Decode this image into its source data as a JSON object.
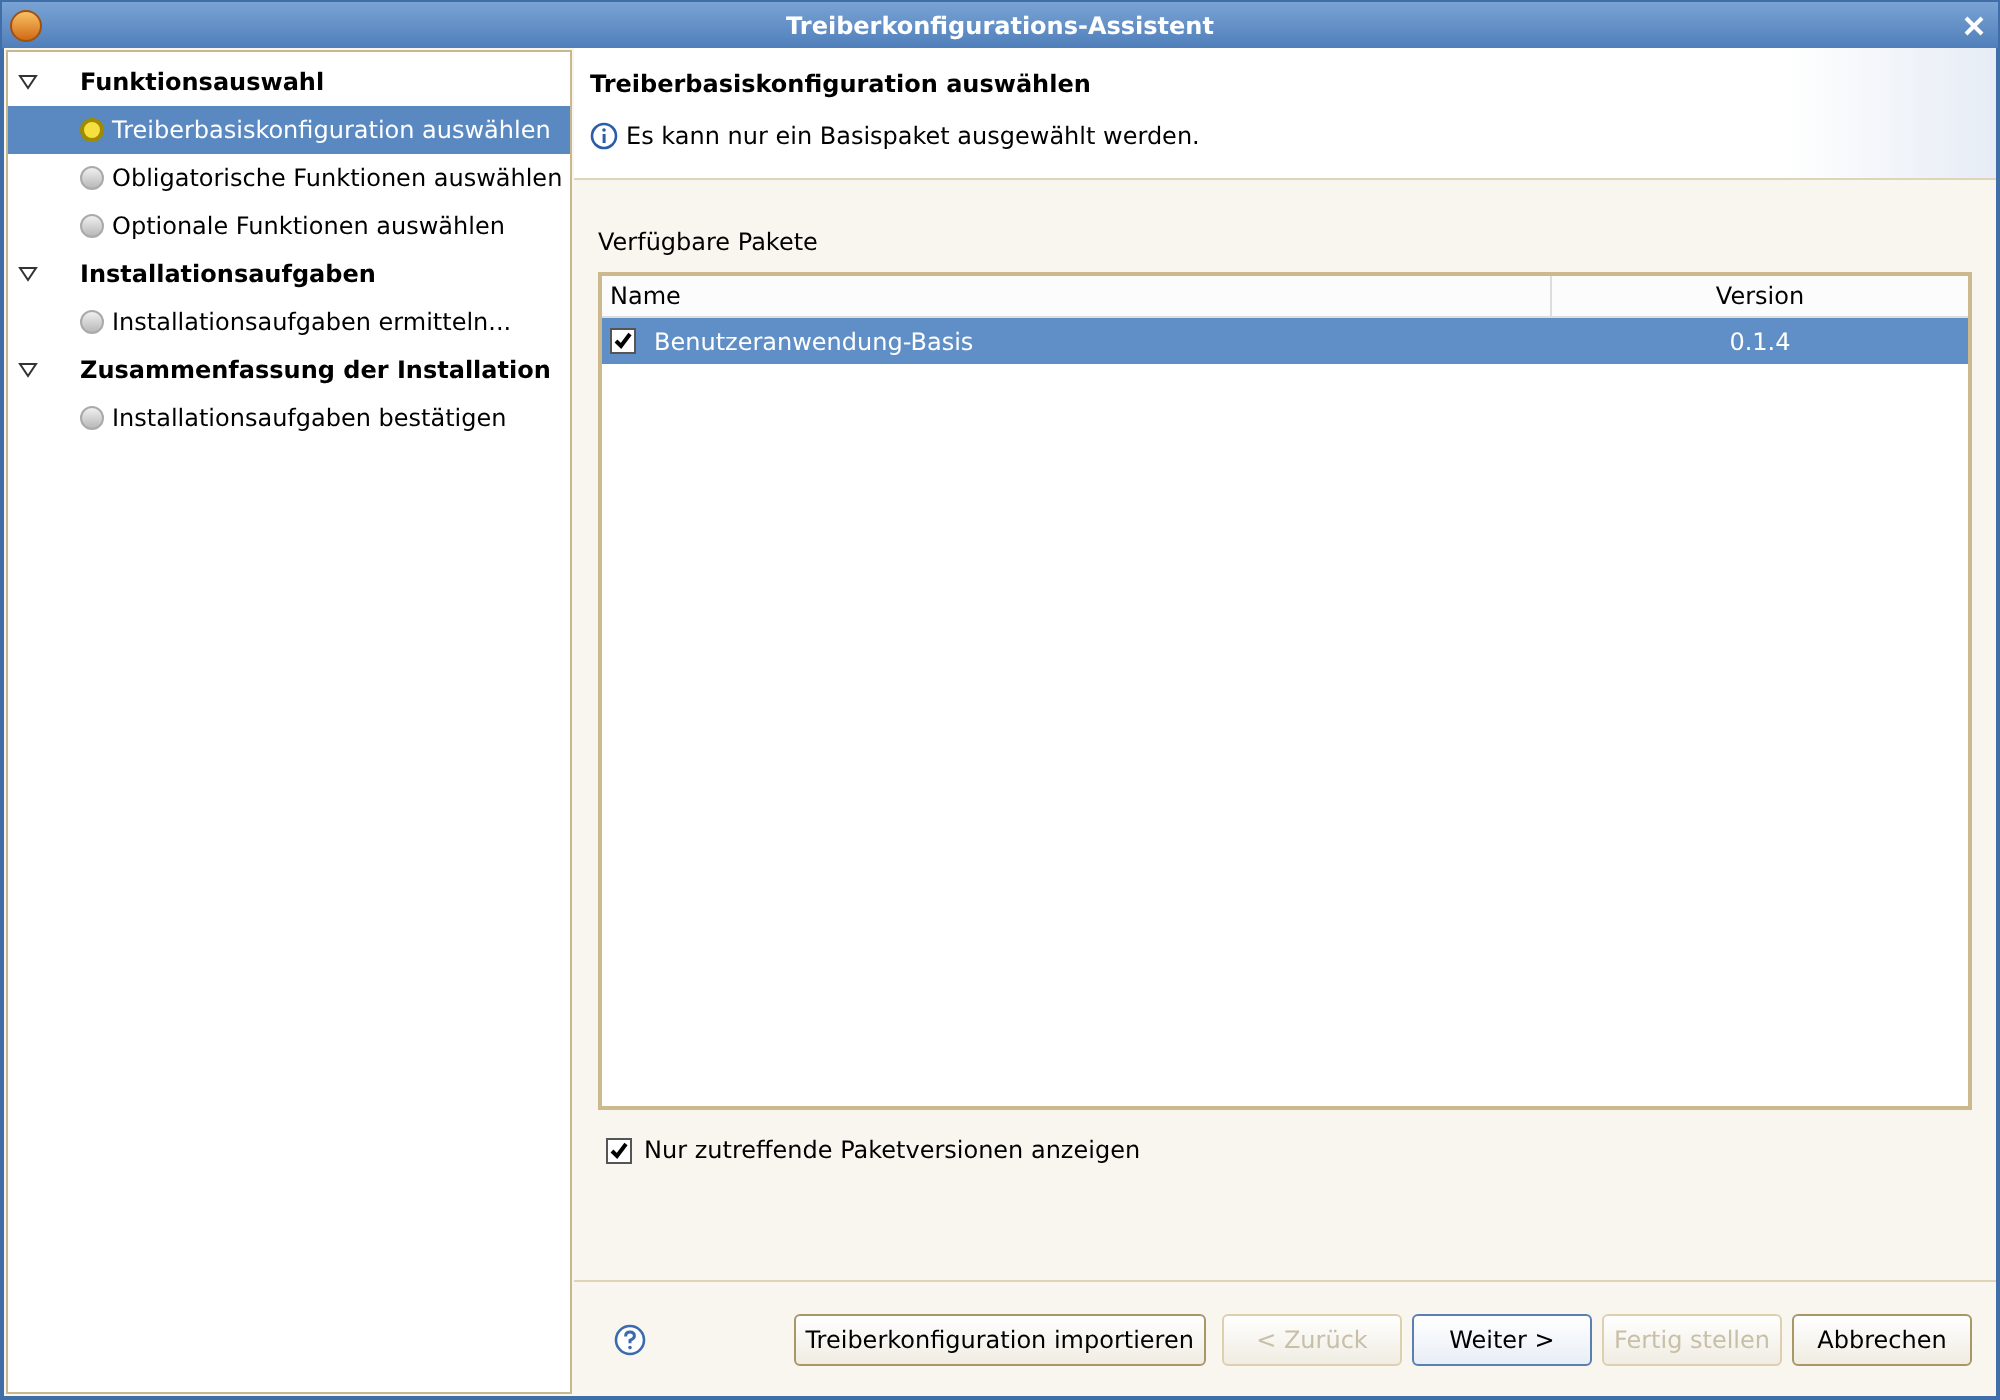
{
  "window": {
    "title": "Treiberkonfigurations-Assistent"
  },
  "steps": [
    {
      "label": "Funktionsauswahl",
      "expanded": true,
      "children": [
        {
          "label": "Treiberbasiskonfiguration auswählen",
          "selected": true,
          "current": true
        },
        {
          "label": "Obligatorische Funktionen auswählen",
          "selected": false,
          "current": false
        },
        {
          "label": "Optionale Funktionen auswählen",
          "selected": false,
          "current": false
        }
      ]
    },
    {
      "label": "Installationsaufgaben",
      "expanded": true,
      "children": [
        {
          "label": "Installationsaufgaben ermitteln...",
          "selected": false,
          "current": false
        }
      ]
    },
    {
      "label": "Zusammenfassung der Installation",
      "expanded": true,
      "children": [
        {
          "label": "Installationsaufgaben bestätigen",
          "selected": false,
          "current": false
        }
      ]
    }
  ],
  "header": {
    "title": "Treiberbasiskonfiguration auswählen",
    "message": "Es kann nur ein Basispaket ausgewählt werden."
  },
  "packages": {
    "label": "Verfügbare Pakete",
    "columns": [
      "Name",
      "Version"
    ],
    "rows": [
      {
        "name": "Benutzeranwendung-Basis",
        "version": "0.1.4",
        "checked": true,
        "selected": true
      }
    ]
  },
  "filter": {
    "label": "Nur zutreffende Paketversionen anzeigen",
    "checked": true
  },
  "buttons": [
    {
      "label": "Treiberkonfiguration importieren",
      "disabled": false,
      "default": false
    },
    {
      "label": "< Zurück",
      "disabled": true,
      "default": false
    },
    {
      "label": "Weiter >",
      "disabled": false,
      "default": true
    },
    {
      "label": "Fertig stellen",
      "disabled": true,
      "default": false
    },
    {
      "label": "Abbrechen",
      "disabled": false,
      "default": false
    }
  ]
}
